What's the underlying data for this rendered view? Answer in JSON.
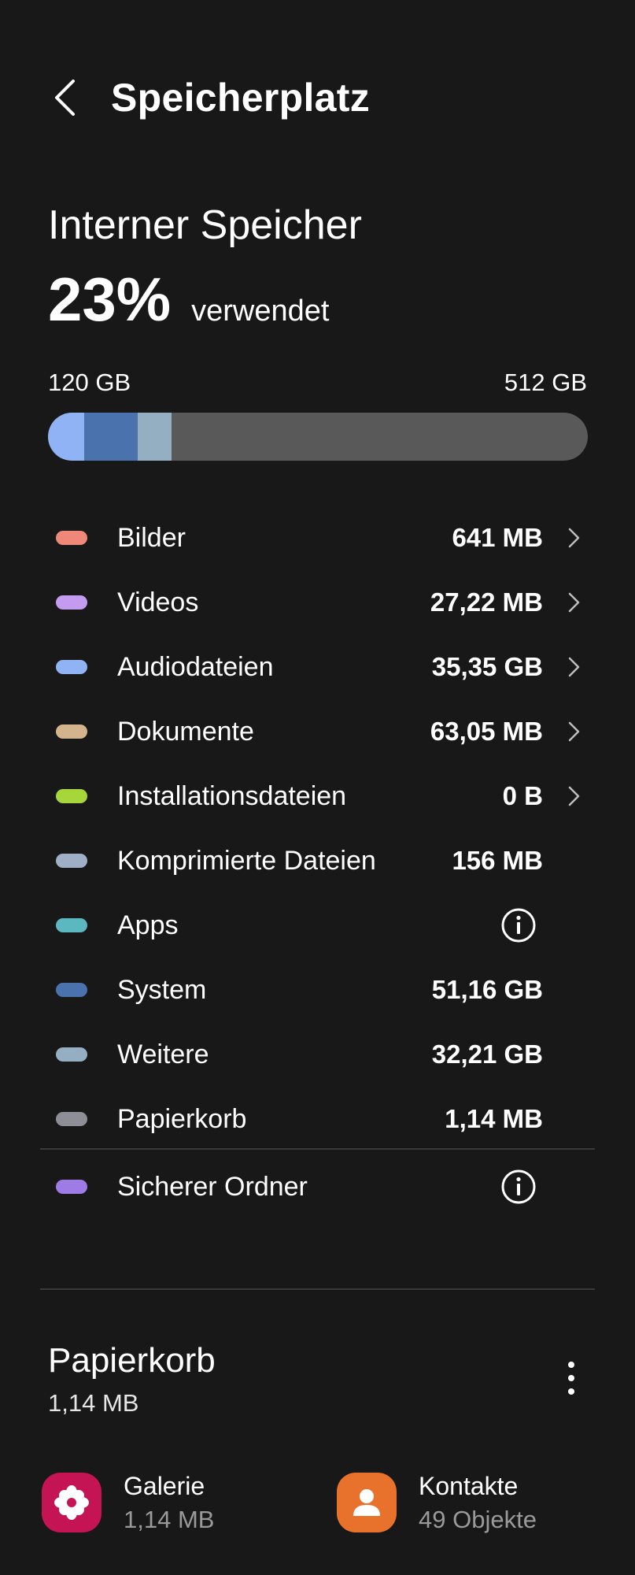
{
  "header": {
    "title": "Speicherplatz"
  },
  "storage": {
    "heading": "Interner Speicher",
    "percent": "23%",
    "percent_label": "verwendet",
    "used": "120 GB",
    "total": "512 GB",
    "bar_segments": [
      {
        "name": "Audiodateien",
        "color": "#8fb3f5"
      },
      {
        "name": "System",
        "color": "#4a72ad"
      },
      {
        "name": "Weitere",
        "color": "#94afc2"
      }
    ],
    "bar_track_color": "#595959"
  },
  "categories": [
    {
      "label": "Bilder",
      "value": "641 MB",
      "color": "#f0887a",
      "action": "chevron"
    },
    {
      "label": "Videos",
      "value": "27,22 MB",
      "color": "#c39cf0",
      "action": "chevron"
    },
    {
      "label": "Audiodateien",
      "value": "35,35 GB",
      "color": "#8fb3f5",
      "action": "chevron"
    },
    {
      "label": "Dokumente",
      "value": "63,05 MB",
      "color": "#d4b48c",
      "action": "chevron"
    },
    {
      "label": "Installationsdateien",
      "value": "0 B",
      "color": "#a6d63a",
      "action": "chevron"
    },
    {
      "label": "Komprimierte Dateien",
      "value": "156 MB",
      "color": "#9fb0c6",
      "action": "none"
    },
    {
      "label": "Apps",
      "value": "",
      "color": "#5cb8c0",
      "action": "info"
    },
    {
      "label": "System",
      "value": "51,16 GB",
      "color": "#4a72ad",
      "action": "none"
    },
    {
      "label": "Weitere",
      "value": "32,21 GB",
      "color": "#94afc2",
      "action": "none"
    },
    {
      "label": "Papierkorb",
      "value": "1,14 MB",
      "color": "#8e8e96",
      "action": "none"
    },
    {
      "label": "Sicherer Ordner",
      "value": "",
      "color": "#9d7ce6",
      "action": "info"
    }
  ],
  "trash": {
    "title": "Papierkorb",
    "size": "1,14 MB",
    "apps": [
      {
        "name": "Galerie",
        "detail": "1,14 MB",
        "icon": "flower-icon",
        "color": "#c41454"
      },
      {
        "name": "Kontakte",
        "detail": "49 Objekte",
        "icon": "person-icon",
        "color": "#e8722b"
      }
    ]
  }
}
